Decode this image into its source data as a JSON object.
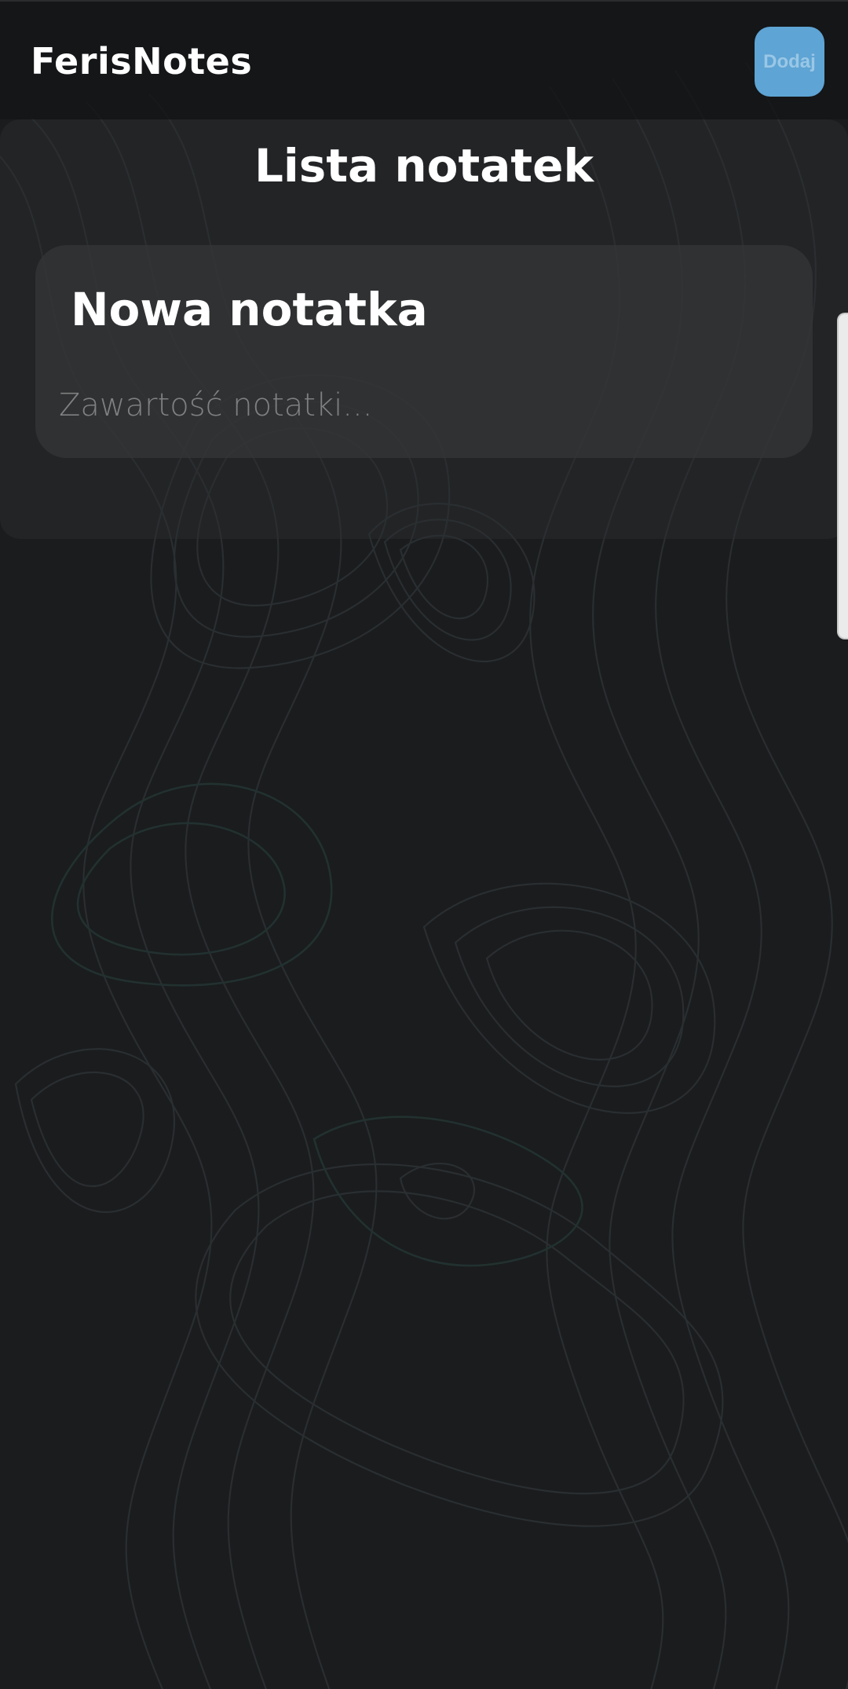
{
  "app": {
    "title": "FerisNotes"
  },
  "header": {
    "add_button_label": "Dodaj"
  },
  "list": {
    "heading": "Lista notatek"
  },
  "new_note": {
    "title_value": "Nowa notatka",
    "content_placeholder": "Zawartość notatki..."
  },
  "colors": {
    "background": "#1a1c1e",
    "accent": "#5ea4d4",
    "text": "#ffffff",
    "placeholder": "#7e8082"
  },
  "background_pattern": "topographic-contour-lines"
}
